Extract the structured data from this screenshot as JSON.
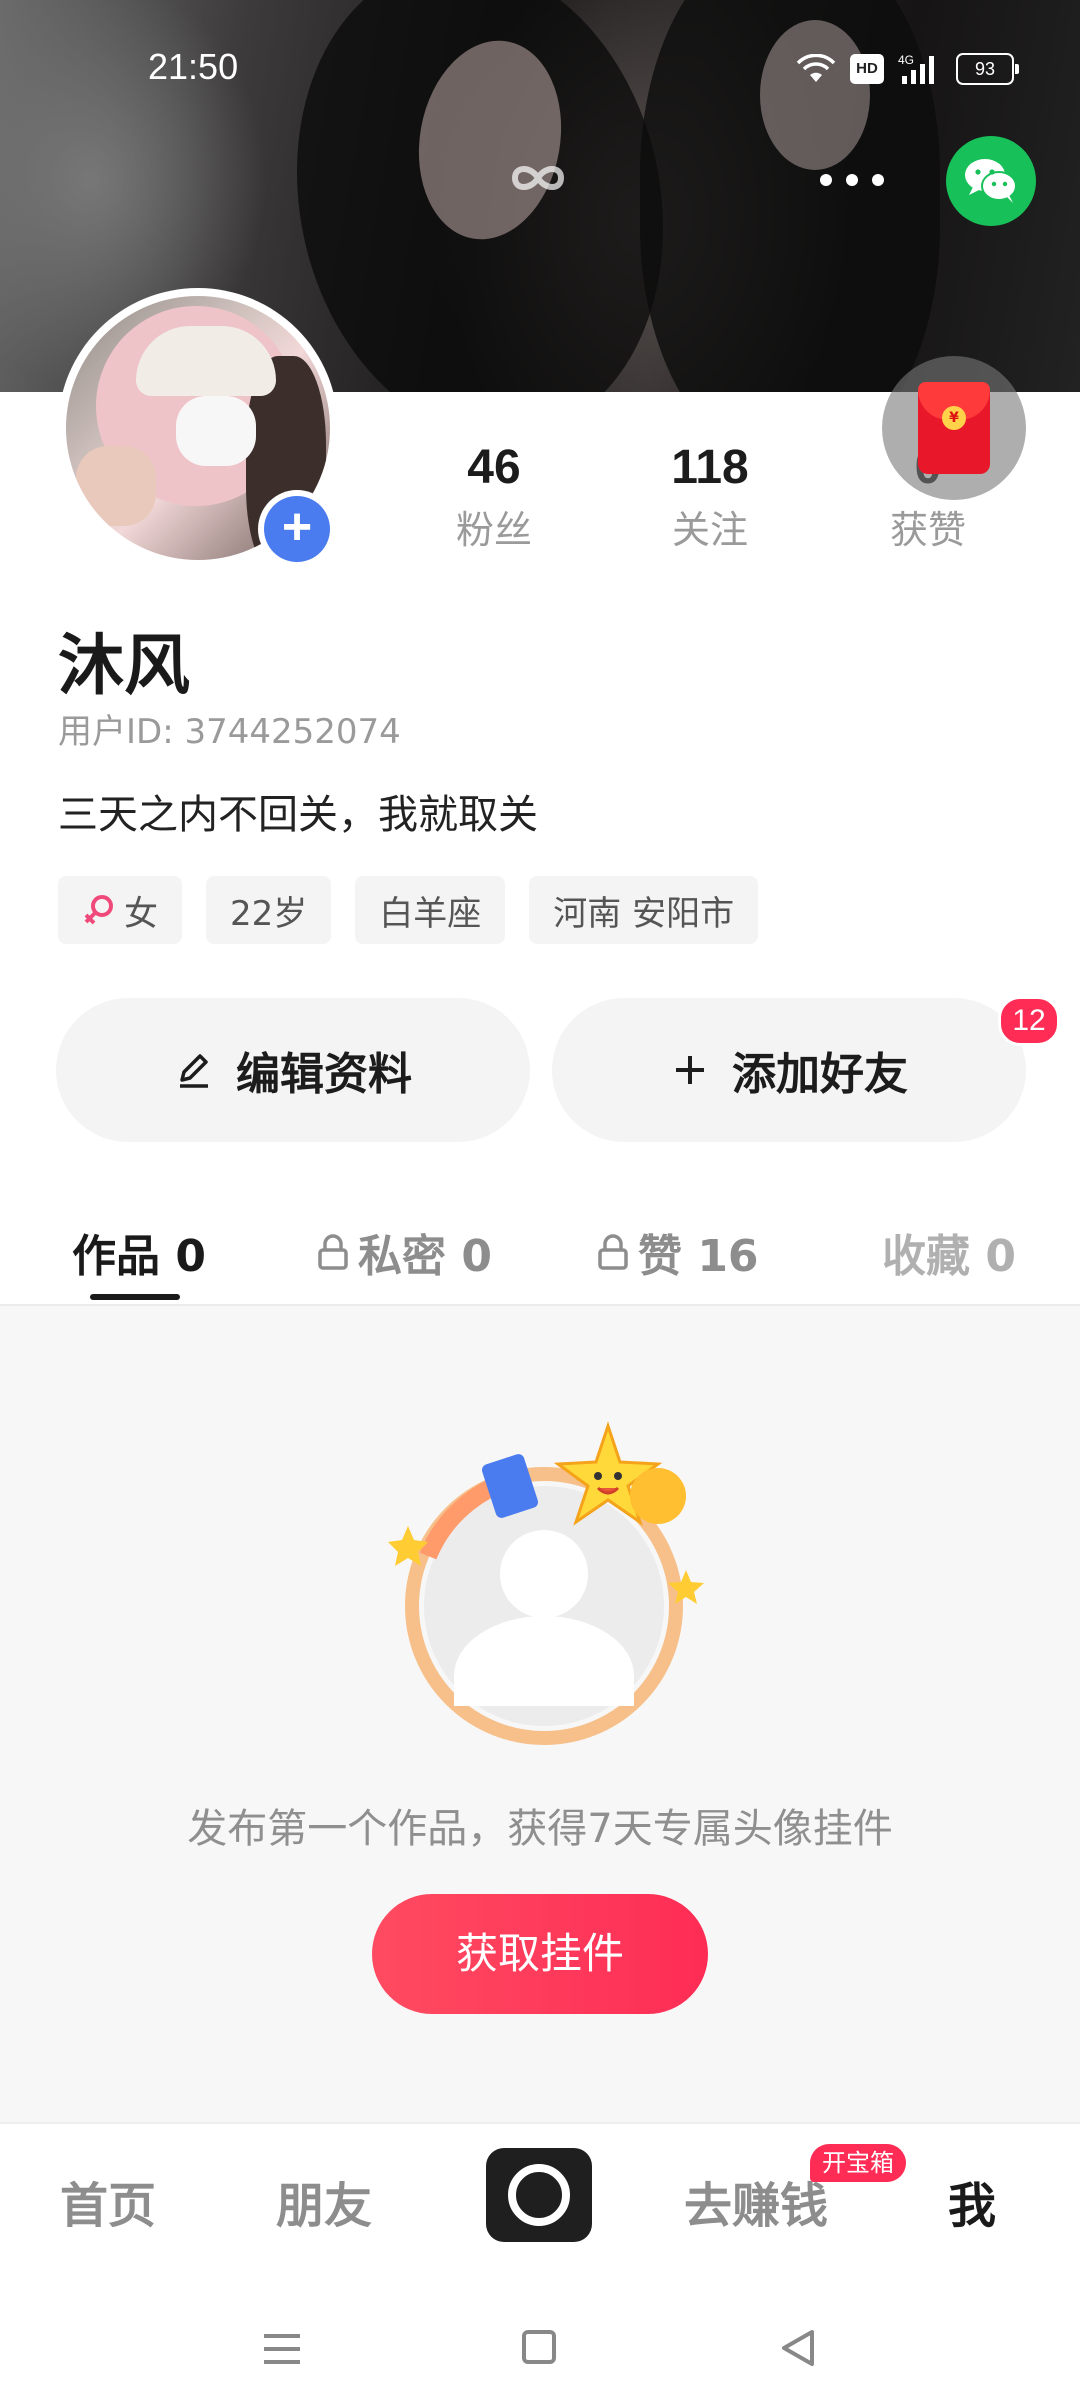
{
  "status_bar": {
    "time": "21:50",
    "hd": "HD",
    "signal": "4G",
    "battery": "93",
    "icons": [
      "wifi-icon",
      "hd-icon",
      "signal-icon",
      "battery-icon"
    ]
  },
  "header": {
    "icons": [
      "infinity-icon",
      "more-icon",
      "wechat-icon"
    ],
    "wechat_color": "#18c05a"
  },
  "profile": {
    "name": "沐风",
    "user_id": "用户ID: 3744252074",
    "bio": "三天之内不回关，我就取关",
    "stats": [
      {
        "num": "46",
        "label": "粉丝"
      },
      {
        "num": "118",
        "label": "关注"
      },
      {
        "num": "0",
        "label": "获赞"
      }
    ],
    "tags": {
      "gender": "女",
      "age": "22岁",
      "zodiac": "白羊座",
      "location": "河南 安阳市"
    }
  },
  "actions": {
    "edit_profile": "编辑资料",
    "add_friend": "添加好友",
    "friend_badge": "12"
  },
  "tabs": [
    {
      "label": "作品 0",
      "active": true
    },
    {
      "label": "私密 0",
      "locked": true
    },
    {
      "label": "赞 16",
      "locked": true
    },
    {
      "label": "收藏 0"
    }
  ],
  "empty_state": {
    "text": "发布第一个作品，获得7天专属头像挂件",
    "button": "获取挂件",
    "button_color": "#fe2c55"
  },
  "bottom_nav": {
    "items": [
      "首页",
      "朋友",
      "去赚钱",
      "我"
    ],
    "chest_badge": "开宝箱",
    "active": "我"
  },
  "system_nav": [
    "menu-icon",
    "home-icon",
    "back-icon"
  ]
}
